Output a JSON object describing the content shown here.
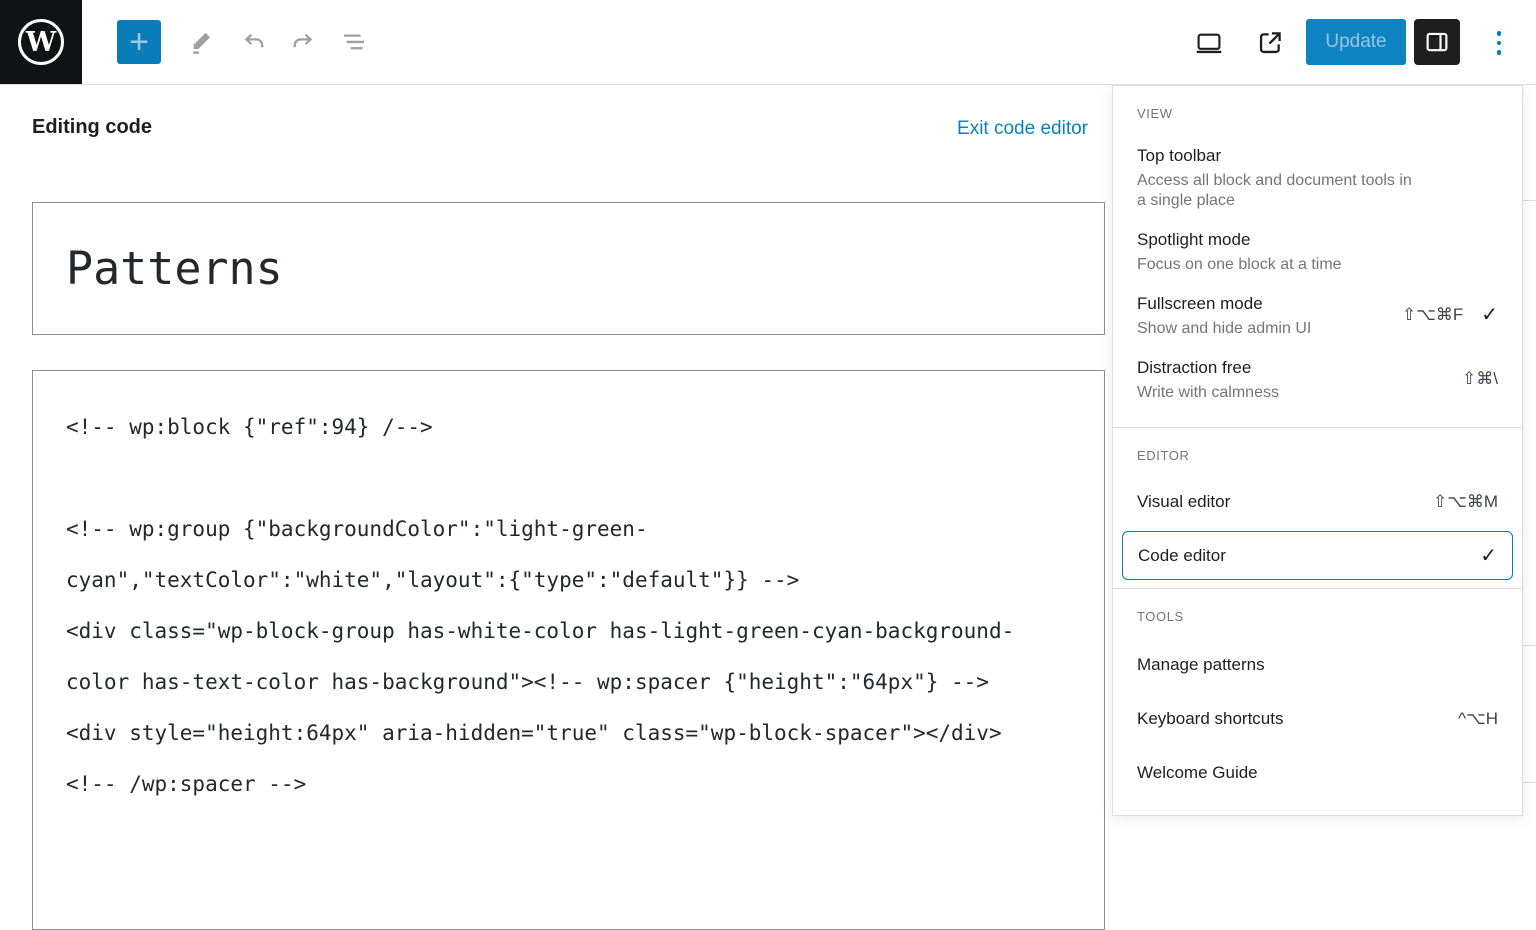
{
  "colors": {
    "accent": "#007cba",
    "toolbar_border": "#dddddd",
    "box_border": "#8c8f94"
  },
  "icons": {
    "wordpress_glyph": "W",
    "plus_glyph": "+",
    "check_glyph": "✓"
  },
  "toolbar": {
    "update_label": "Update"
  },
  "header": {
    "title": "Editing code",
    "exit_link": "Exit code editor"
  },
  "document": {
    "title": "Patterns",
    "code_lines": [
      "<!-- wp:block {\"ref\":94} /-->",
      "",
      "<!-- wp:group {\"backgroundColor\":\"light-green-",
      "cyan\",\"textColor\":\"white\",\"layout\":{\"type\":\"default\"}} -->",
      "<div class=\"wp-block-group has-white-color has-light-green-cyan-background-",
      "color has-text-color has-background\"><!-- wp:spacer {\"height\":\"64px\"} -->",
      "<div style=\"height:64px\" aria-hidden=\"true\" class=\"wp-block-spacer\"></div>",
      "<!-- /wp:spacer -->"
    ]
  },
  "menu": {
    "groups": [
      {
        "label": "VIEW",
        "items": [
          {
            "title": "Top toolbar",
            "help": "Access all block and document tools in a single place"
          },
          {
            "title": "Spotlight mode",
            "help": "Focus on one block at a time"
          },
          {
            "title": "Fullscreen mode",
            "help": "Show and hide admin UI",
            "shortcut": "⇧⌥⌘F",
            "checked": true
          },
          {
            "title": "Distraction free",
            "help": "Write with calmness",
            "shortcut": "⇧⌘\\"
          }
        ]
      },
      {
        "label": "EDITOR",
        "items": [
          {
            "title": "Visual editor",
            "shortcut": "⇧⌥⌘M"
          },
          {
            "title": "Code editor",
            "checked": true,
            "focused": true
          }
        ]
      },
      {
        "label": "TOOLS",
        "items": [
          {
            "title": "Manage patterns"
          },
          {
            "title": "Keyboard shortcuts",
            "shortcut": "^⌥H"
          },
          {
            "title": "Welcome Guide"
          }
        ]
      }
    ]
  }
}
